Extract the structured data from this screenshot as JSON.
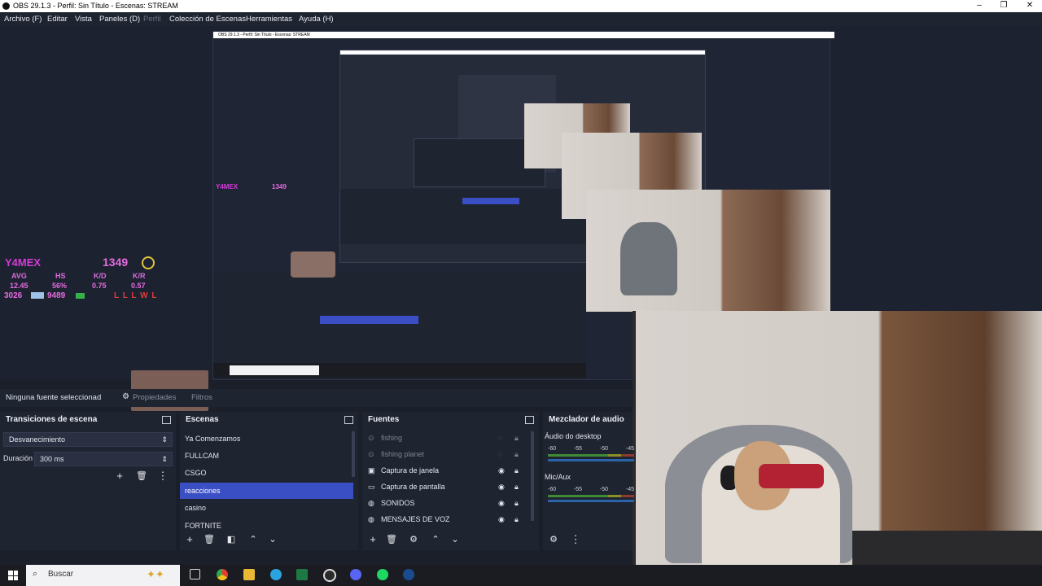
{
  "window": {
    "title": "OBS 29.1.3 - Perfil: Sin Título - Escenas: STREAM",
    "nested_title": "OBS 29.1.3 - Perfil: Sin Título - Escenas: STREAM",
    "minimize": "–",
    "maximize": "❐",
    "close": "✕"
  },
  "menu": [
    {
      "label": "Archivo (F)",
      "disabled": false
    },
    {
      "label": "Editar",
      "disabled": false
    },
    {
      "label": "Vista",
      "disabled": false
    },
    {
      "label": "Paneles (D)",
      "disabled": false
    },
    {
      "label": "Perfil",
      "disabled": true
    },
    {
      "label": "Colección de Escenas",
      "disabled": false
    },
    {
      "label": "Herramientas",
      "disabled": false
    },
    {
      "label": "Ayuda (H)",
      "disabled": false
    }
  ],
  "overlay": {
    "name": "Y4MEX",
    "score": "1349",
    "labels": [
      "AVG",
      "HS",
      "K/D",
      "K/R"
    ],
    "values": [
      "12.45",
      "56%",
      "0.75",
      "0.57"
    ],
    "elo": "3026",
    "elo2": "9489",
    "streak": "L L L W L"
  },
  "source_bar": {
    "no_source": "Ninguna fuente seleccionad",
    "properties": "Propiedades",
    "filters": "Filtros"
  },
  "transitions": {
    "title": "Transiciones de escena",
    "selected": "Desvanecimiento",
    "duration_label": "Duración",
    "duration_value": "300 ms"
  },
  "scenes": {
    "title": "Escenas",
    "items": [
      "Ya Comenzamos",
      "FULLCAM",
      "CSGO",
      "reacciones",
      "casino",
      "FORTNITE"
    ],
    "selected_index": 3
  },
  "sources": {
    "title": "Fuentes",
    "items": [
      {
        "label": "fishing",
        "hidden": true
      },
      {
        "label": "fishing planet",
        "hidden": true
      },
      {
        "label": "Captura de janela",
        "hidden": false
      },
      {
        "label": "Captura de pantalla",
        "hidden": false
      },
      {
        "label": "SONIDOS",
        "hidden": false
      },
      {
        "label": "MENSAJES DE VOZ",
        "hidden": false
      }
    ]
  },
  "mixer": {
    "title": "Mezclador de audio",
    "channels": [
      {
        "name": "Áudio do desktop",
        "scale": [
          "-60",
          "-55",
          "-50",
          "-45"
        ]
      },
      {
        "name": "Mic/Aux",
        "scale": [
          "-60",
          "-55",
          "-50",
          "-45"
        ]
      }
    ]
  },
  "taskbar": {
    "search_placeholder": "Buscar"
  },
  "colors": {
    "accent": "#3a4fc3",
    "overlay_name": "#d43bd8",
    "overlay_score": "#e66be0",
    "overlay_win": "#3fd24a",
    "overlay_loss": "#e23c3c"
  }
}
